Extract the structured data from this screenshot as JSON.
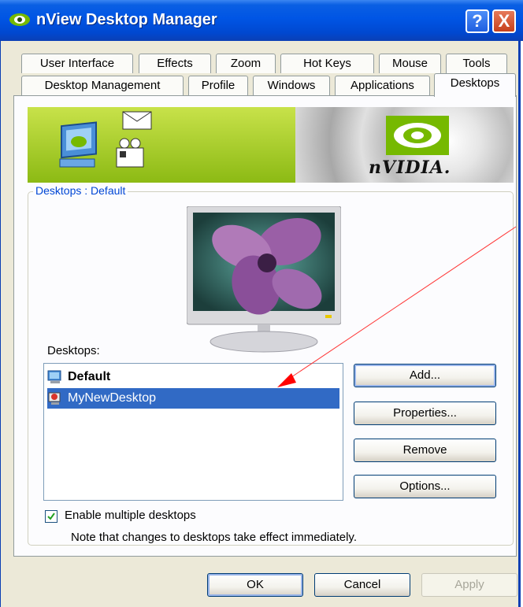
{
  "window": {
    "title": "nView Desktop Manager",
    "help_button": "?",
    "close_button": "X"
  },
  "tabs": {
    "row1": [
      "User Interface",
      "Effects",
      "Zoom",
      "Hot Keys",
      "Mouse",
      "Tools"
    ],
    "row2": [
      "Desktop Management",
      "Profile",
      "Windows",
      "Applications",
      "Desktops"
    ],
    "active": "Desktops"
  },
  "banner": {
    "brand": "nVIDIA.",
    "background_color": "#8fbe1c"
  },
  "group": {
    "label": "Desktops : Default"
  },
  "desktops": {
    "label": "Desktops:",
    "items": [
      {
        "name": "Default",
        "bold": true,
        "selected": false,
        "icon": "desktop-icon"
      },
      {
        "name": "MyNewDesktop",
        "bold": false,
        "selected": true,
        "icon": "new-desktop-icon"
      }
    ]
  },
  "side_buttons": {
    "add": "Add...",
    "properties": "Properties...",
    "remove": "Remove",
    "options": "Options..."
  },
  "enable_multiple": {
    "label": "Enable multiple desktops",
    "checked": true
  },
  "note": "Note that changes to desktops take effect immediately.",
  "dialog_buttons": {
    "ok": "OK",
    "cancel": "Cancel",
    "apply": "Apply"
  },
  "colors": {
    "selection": "#316ac5",
    "titlebar": "#0055e5",
    "annotation_arrow": "#ff0000"
  }
}
